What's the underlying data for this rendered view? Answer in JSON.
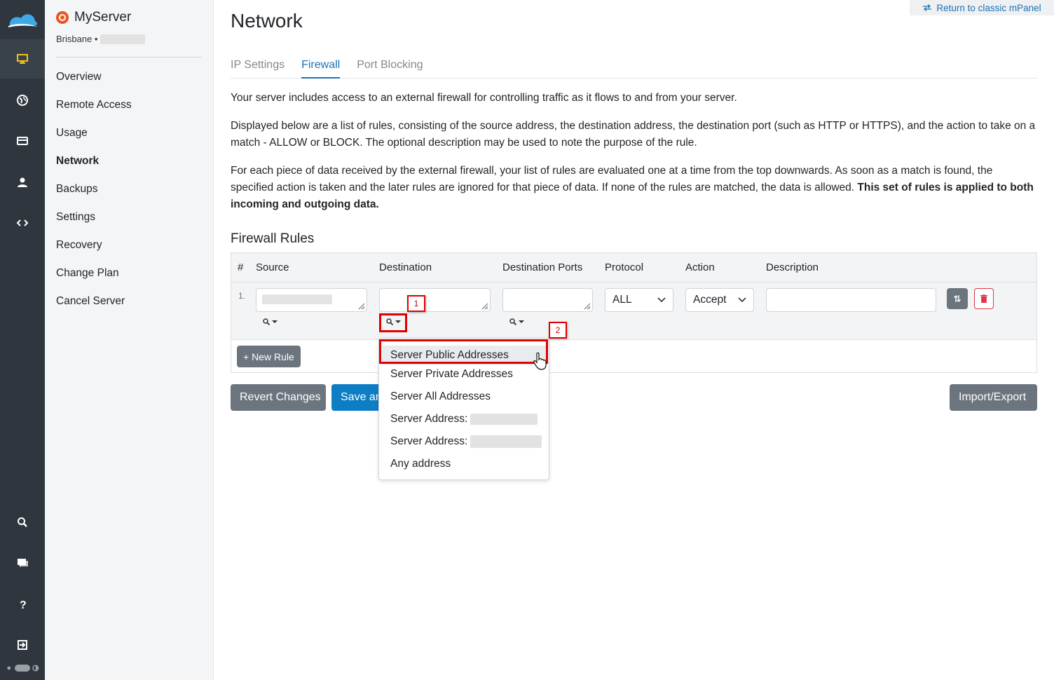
{
  "app": {
    "return_link": "Return to classic mPanel"
  },
  "server": {
    "name": "MyServer",
    "location": "Brisbane •"
  },
  "nav": {
    "items": [
      "Overview",
      "Remote Access",
      "Usage",
      "Network",
      "Backups",
      "Settings",
      "Recovery",
      "Change Plan",
      "Cancel Server"
    ],
    "active": "Network"
  },
  "rail_icons": [
    "cloud-logo-icon",
    "monitor-icon",
    "globe-icon",
    "card-icon",
    "user-icon",
    "code-icon",
    "search-icon",
    "chat-icon",
    "help-icon",
    "logout-icon",
    "theme-toggle-icon"
  ],
  "page": {
    "title": "Network",
    "tabs": [
      "IP Settings",
      "Firewall",
      "Port Blocking"
    ],
    "active_tab": "Firewall",
    "para1": "Your server includes access to an external firewall for controlling traffic as it flows to and from your server.",
    "para2": "Displayed below are a list of rules, consisting of the source address, the destination address, the destination port (such as HTTP or HTTPS), and the action to take on a match - ALLOW or BLOCK. The optional description may be used to note the purpose of the rule.",
    "para3": "For each piece of data received by the external firewall, your list of rules are evaluated one at a time from the top downwards. As soon as a match is found, the specified action is taken and the later rules are ignored for that piece of data. If none of the rules are matched, the data is allowed.",
    "para3_bold": "This set of rules is applied to both incoming and outgoing data."
  },
  "firewall": {
    "section_title": "Firewall Rules",
    "columns": [
      "#",
      "Source",
      "Destination",
      "Destination Ports",
      "Protocol",
      "Action",
      "Description"
    ],
    "rows": [
      {
        "num": "1.",
        "source": "",
        "destination": "",
        "ports": "",
        "protocol": "ALL",
        "action": "Accept",
        "description": ""
      }
    ],
    "new_rule_label": "+ New Rule"
  },
  "buttons": {
    "revert": "Revert Changes",
    "save": "Save an",
    "import_export": "Import/Export"
  },
  "dropdown": {
    "items": [
      "Server Public Addresses",
      "Server Private Addresses",
      "Server All Addresses",
      "Server Address:",
      "Server Address:",
      "Any address"
    ],
    "highlighted": "Server Public Addresses"
  },
  "annotations": [
    "1",
    "2"
  ],
  "colors": {
    "rail_bg": "#2f363d",
    "accent_blue": "#1a73b8",
    "active_icon": "#f0c419",
    "highlight_red": "#e00000"
  }
}
